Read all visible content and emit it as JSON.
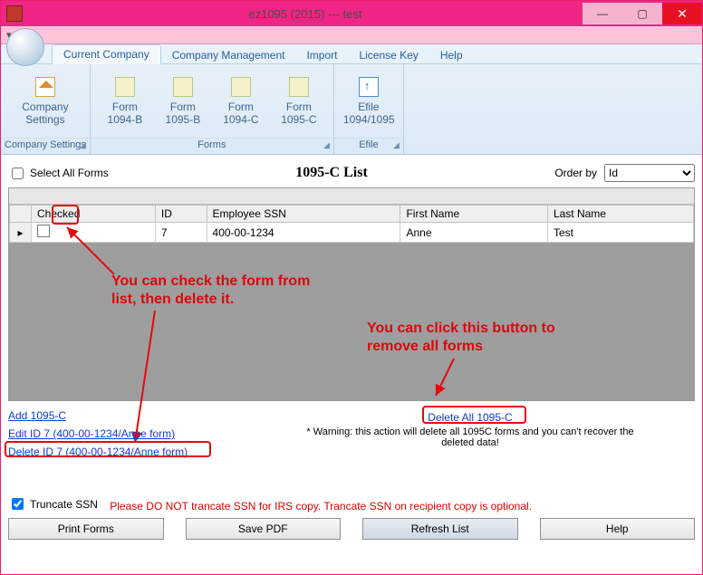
{
  "window": {
    "title": "ez1095 (2015) --- test"
  },
  "tabs": [
    "Current Company",
    "Company Management",
    "Import",
    "License Key",
    "Help"
  ],
  "active_tab": 0,
  "ribbon": {
    "groups": [
      {
        "caption": "Company Settings",
        "items": [
          {
            "label": "Company\nSettings",
            "icon": "home"
          }
        ]
      },
      {
        "caption": "Forms",
        "items": [
          {
            "label": "Form\n1094-B",
            "icon": "doc"
          },
          {
            "label": "Form\n1095-B",
            "icon": "doc"
          },
          {
            "label": "Form\n1094-C",
            "icon": "doc"
          },
          {
            "label": "Form\n1095-C",
            "icon": "doc"
          }
        ]
      },
      {
        "caption": "Efile",
        "items": [
          {
            "label": "Efile\n1094/1095",
            "icon": "up"
          }
        ]
      }
    ]
  },
  "list": {
    "select_all_label": "Select All Forms",
    "title": "1095-C List",
    "order_by_label": "Order by",
    "order_by_value": "Id",
    "columns": [
      "Checked",
      "ID",
      "Employee SSN",
      "First Name",
      "Last Name"
    ],
    "rows": [
      {
        "checked": false,
        "id": "7",
        "ssn": "400-00-1234",
        "first": "Anne",
        "last": "Test"
      }
    ]
  },
  "links": {
    "add": "Add 1095-C",
    "edit": "Edit ID 7 (400-00-1234/Anne form)",
    "del": "Delete ID 7 (400-00-1234/Anne form)",
    "del_all": "Delete All 1095-C",
    "warning": "* Warning: this action will delete all 1095C forms and you can't recover the deleted data!"
  },
  "truncate": {
    "label": "Truncate SSN",
    "note": "Please DO NOT trancate SSN for IRS copy. Trancate SSN on recipient copy is optional."
  },
  "buttons": {
    "print": "Print Forms",
    "save": "Save PDF",
    "refresh": "Refresh List",
    "help": "Help"
  },
  "annotations": {
    "a1": "You can check the form from\nlist, then delete it.",
    "a2": "You can click this button to\nremove all forms"
  }
}
